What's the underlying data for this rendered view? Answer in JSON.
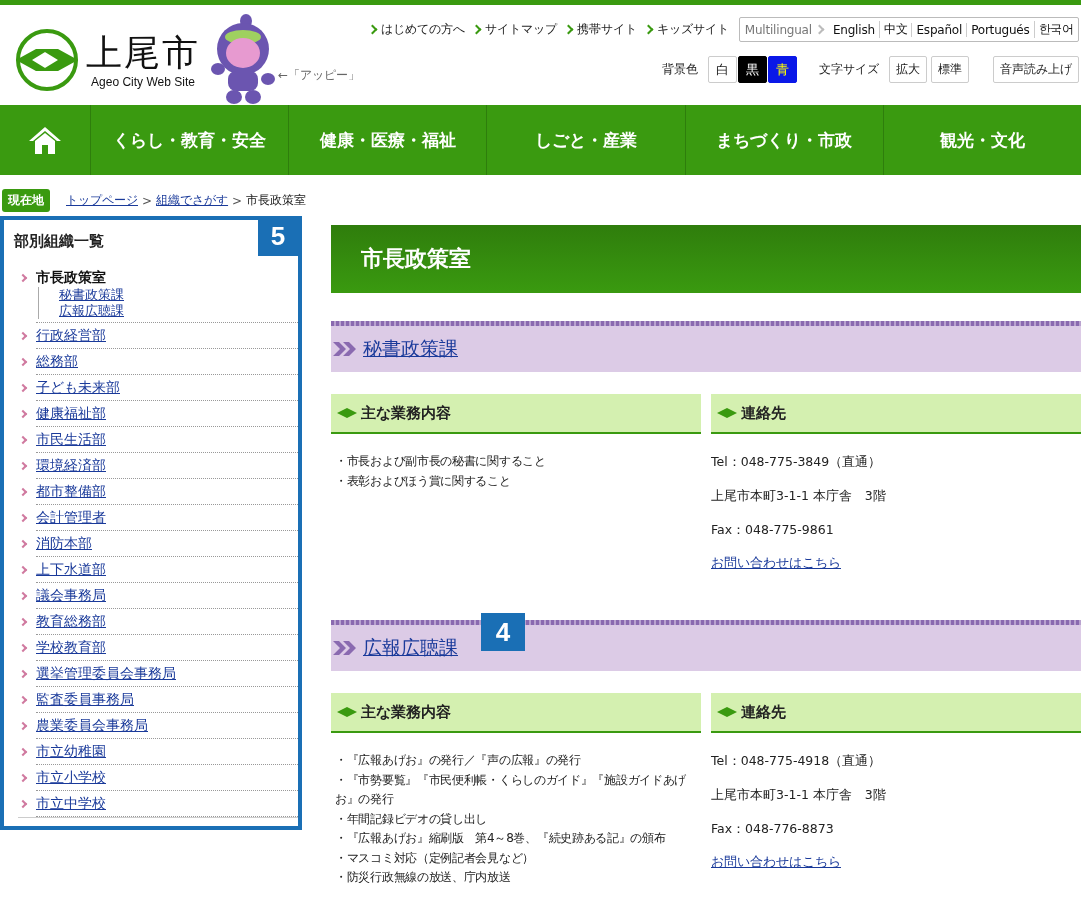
{
  "header": {
    "logo_text": "上尾市",
    "logo_subtitle": "Ageo City Web Site",
    "mascot_caption": "←「アッピー」",
    "top_links": [
      "はじめての方へ",
      "サイトマップ",
      "携帯サイト",
      "キッズサイト"
    ],
    "multilingual": {
      "label": "Multilingual",
      "languages": [
        "English",
        "中文",
        "Español",
        "Portugués",
        "한국어"
      ]
    },
    "background_color": {
      "label": "背景色",
      "options": [
        {
          "label": "白",
          "kind": "white"
        },
        {
          "label": "黒",
          "kind": "black"
        },
        {
          "label": "青",
          "kind": "blue"
        }
      ]
    },
    "text_size": {
      "label": "文字サイズ",
      "options": [
        "拡大",
        "標準"
      ]
    },
    "read_aloud": "音声読み上げ"
  },
  "nav": {
    "items": [
      "くらし・教育・安全",
      "健康・医療・福祉",
      "しごと・産業",
      "まちづくり・市政",
      "観光・文化"
    ]
  },
  "breadcrumb": {
    "badge": "現在地",
    "links": [
      {
        "label": "トップページ",
        "separator": ">"
      },
      {
        "label": "組織でさがす",
        "separator": ">"
      }
    ],
    "current": "市長政策室"
  },
  "sidebar": {
    "title": "部別組織一覧",
    "callout": "5",
    "items": [
      {
        "label": "市長政策室",
        "selected": true,
        "children": [
          "秘書政策課",
          "広報広聴課"
        ]
      },
      {
        "label": "行政経営部",
        "selected": false
      },
      {
        "label": "総務部",
        "selected": false
      },
      {
        "label": "子ども未来部",
        "selected": false
      },
      {
        "label": "健康福祉部",
        "selected": false
      },
      {
        "label": "市民生活部",
        "selected": false
      },
      {
        "label": "環境経済部",
        "selected": false
      },
      {
        "label": "都市整備部",
        "selected": false
      },
      {
        "label": "会計管理者",
        "selected": false
      },
      {
        "label": "消防本部",
        "selected": false
      },
      {
        "label": "上下水道部",
        "selected": false
      },
      {
        "label": "議会事務局",
        "selected": false
      },
      {
        "label": "教育総務部",
        "selected": false
      },
      {
        "label": "学校教育部",
        "selected": false
      },
      {
        "label": "選挙管理委員会事務局",
        "selected": false
      },
      {
        "label": "監査委員事務局",
        "selected": false
      },
      {
        "label": "農業委員会事務局",
        "selected": false
      },
      {
        "label": "市立幼稚園",
        "selected": false
      },
      {
        "label": "市立小学校",
        "selected": false
      },
      {
        "label": "市立中学校",
        "selected": false
      }
    ]
  },
  "page_title": "市長政策室",
  "sections": [
    {
      "title": "秘書政策課",
      "duties_heading": "主な業務内容",
      "duties": [
        "・市長および副市長の秘書に関すること",
        "・表彰およびほう賞に関すること"
      ],
      "contact_heading": "連絡先",
      "tel": "Tel：048-775-3849（直通）",
      "address": "上尾市本町3-1-1 本庁舎　3階",
      "fax": "Fax：048-775-9861",
      "inquiry_link": "お問い合わせはこちら"
    },
    {
      "title": "広報広聴課",
      "callout": "4",
      "duties_heading": "主な業務内容",
      "duties": [
        "・『広報あげお』の発行／『声の広報』の発行",
        "・『市勢要覧』『市民便利帳・くらしのガイド』『施設ガイドあげお』の発行",
        "・年間記録ビデオの貸し出し",
        "・『広報あげお』縮刷版　第4～8巻、『続史跡ある記』の頒布",
        "・マスコミ対応（定例記者会見など）",
        "・防災行政無線の放送、庁内放送"
      ],
      "contact_heading": "連絡先",
      "tel": "Tel：048-775-4918（直通）",
      "address": "上尾市本町3-1-1 本庁舎　3階",
      "fax": "Fax：048-776-8873",
      "inquiry_link": "お問い合わせはこちら"
    }
  ]
}
